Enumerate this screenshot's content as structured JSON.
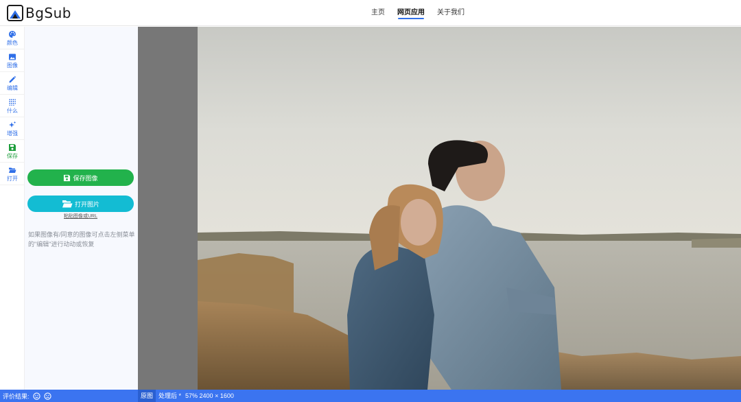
{
  "app": {
    "logo_text": "BgSub"
  },
  "nav": {
    "items": [
      {
        "label": "主页"
      },
      {
        "label": "网页应用",
        "active": true
      },
      {
        "label": "关于我们"
      }
    ]
  },
  "sidebar": {
    "items": [
      {
        "label": "颜色",
        "icon": "palette-icon"
      },
      {
        "label": "图像",
        "icon": "image-icon"
      },
      {
        "label": "编辑",
        "icon": "pencil-icon"
      },
      {
        "label": "什么",
        "icon": "grid-icon"
      },
      {
        "label": "增强",
        "icon": "sparkle-icon"
      },
      {
        "label": "保存",
        "icon": "save-icon"
      },
      {
        "label": "打开",
        "icon": "folder-icon"
      }
    ]
  },
  "panel": {
    "save_button": "保存图像",
    "open_button": "打开图片",
    "paste_link": "粘贴图像或URL",
    "hint": "如果图像有/同意的图像可点击左侧菜单的\"编辑\"进行动动或恢复"
  },
  "statusbar": {
    "rating_label": "评价结果:",
    "tab_original": "原图",
    "tab_processed": "处理后 *",
    "zoom_info": "57% 2400 × 1600"
  },
  "colors": {
    "accent": "#3b74f0",
    "save_green": "#22b24c",
    "open_cyan": "#13bcd3"
  }
}
